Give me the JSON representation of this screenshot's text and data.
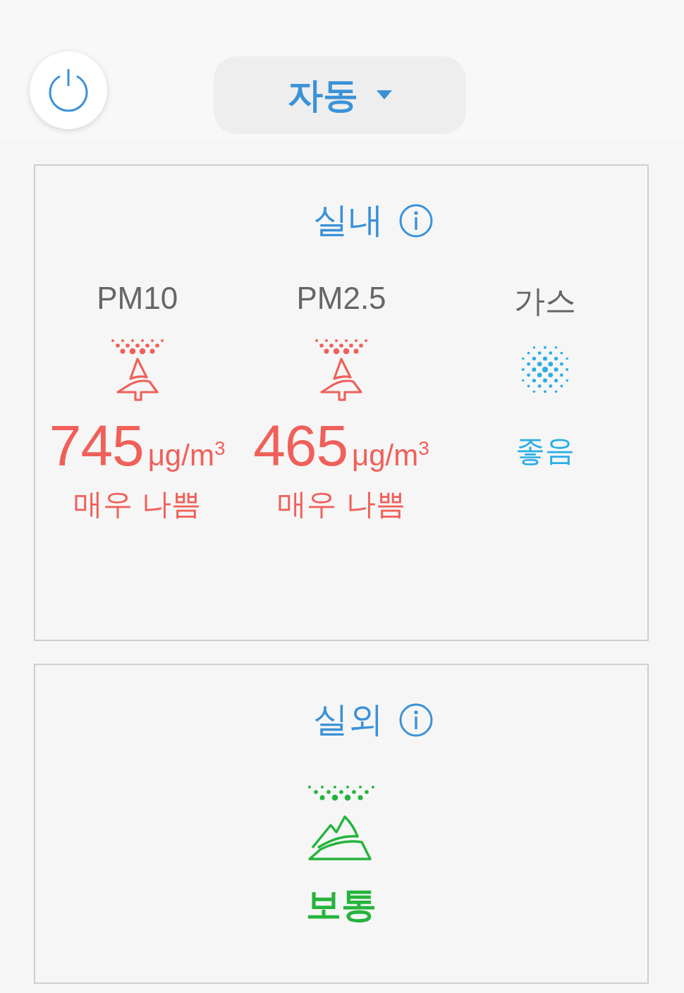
{
  "mode": {
    "label": "자동"
  },
  "indoor": {
    "title": "실내",
    "metrics": [
      {
        "label": "PM10",
        "kind": "tree",
        "value": "745",
        "unit": "μg/m",
        "unit_sup": "3",
        "status": "매우 나쁨",
        "color": "#f0605a"
      },
      {
        "label": "PM2.5",
        "kind": "tree",
        "value": "465",
        "unit": "μg/m",
        "unit_sup": "3",
        "status": "매우 나쁨",
        "color": "#f0605a"
      },
      {
        "label": "가스",
        "kind": "dots",
        "status": "좋음",
        "color": "#2aaee6"
      }
    ]
  },
  "outdoor": {
    "title": "실외",
    "kind": "mountain",
    "status": "보통",
    "color": "#25b43c"
  }
}
